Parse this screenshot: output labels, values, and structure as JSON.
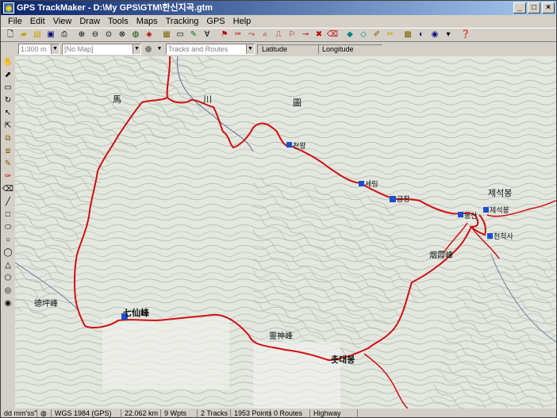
{
  "window": {
    "title": "GPS TrackMaker - D:\\My GPS\\GTM\\한신지곡.gtm",
    "controls": [
      "_",
      "□",
      "×"
    ]
  },
  "menu": [
    "File",
    "Edit",
    "View",
    "Draw",
    "Tools",
    "Maps",
    "Tracking",
    "GPS",
    "Help"
  ],
  "toolbar2": {
    "scale_value": "1:300 m",
    "map_value": "[No Map]",
    "tracks_placeholder": "Tracks and Routes",
    "latitude_label": "Latitude",
    "longitude_label": "Longitude"
  },
  "map": {
    "waypoints": [
      "천왕",
      "세림",
      "금장",
      "동산",
      "제석봉",
      "천척사"
    ],
    "labels": {
      "peak_top_right": "제석봉",
      "chilseon": "七仙峰",
      "deokpyeong": "德坪峰",
      "yeongsin": "靈神峰",
      "chotdaebong": "촛대봉",
      "yeonha": "烟霞峰",
      "ma": "馬",
      "cheon": "川",
      "do": "圖"
    }
  },
  "status": {
    "coord_format": "dd mm'ss\"",
    "datum": "WGS 1984 (GPS)",
    "distance": "22.062 km",
    "waypoints": "9 Wpts",
    "tracks": "2 Tracks",
    "points": "1953 Points",
    "routes": "0 Routes",
    "layer": "Highway"
  }
}
